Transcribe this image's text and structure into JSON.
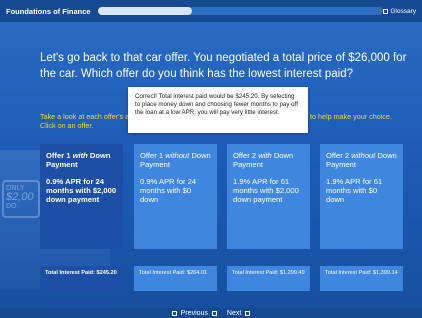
{
  "course": {
    "title": "Foundations of Finance",
    "progress": 0.33
  },
  "glossary_label": "Glossary",
  "question": "Let's go back to that car offer. You negotiated a total price of $26,000 for the car. Which offer do you think has the lowest interest paid?",
  "instruction_left": "Take a look at each offer's a",
  "instruction_left_2": "Click on an offer.",
  "instruction_right": "ent to help make your choice.",
  "feedback": "Correct! Total interest paid would be $245.20. By selecting to place money down and choosing fewer months to pay off the loan at a low APR, you will pay very little interest.",
  "background": {
    "sign_small": "ONLY",
    "sign_big": "$2,00",
    "sign_small2": "DO"
  },
  "offers": [
    {
      "name_prefix": "Offer 1 ",
      "name_em": "with",
      "name_suffix": " Down Payment",
      "detail": "0.9% APR for 24 months with $2,000 down payment",
      "result": "Total Interest Paid: $245.20"
    },
    {
      "name_prefix": "Offer 1 ",
      "name_em": "without",
      "name_suffix": " Down Payment",
      "detail": "0.9% APR for 24 months with $0 down",
      "result": "Total Interest Paid: $264.01"
    },
    {
      "name_prefix": "Offer 2 ",
      "name_em": "with",
      "name_suffix": " Down Payment",
      "detail": "1.9% APR for 61 months with $2,000 down payment",
      "result": "Total Interest Paid: $1,299.49"
    },
    {
      "name_prefix": "Offer 2 ",
      "name_em": "without",
      "name_suffix": " Down Payment",
      "detail": "1.9% APR for 61 months with $0 down",
      "result": "Total Interest Paid: $1,399.14"
    }
  ],
  "nav": {
    "previous": "Previous",
    "next": "Next"
  },
  "colors": {
    "background": "#1f5fb5",
    "card": "#3f86e0",
    "card_selected": "#1e4fa6",
    "instruction": "#f5d742"
  }
}
